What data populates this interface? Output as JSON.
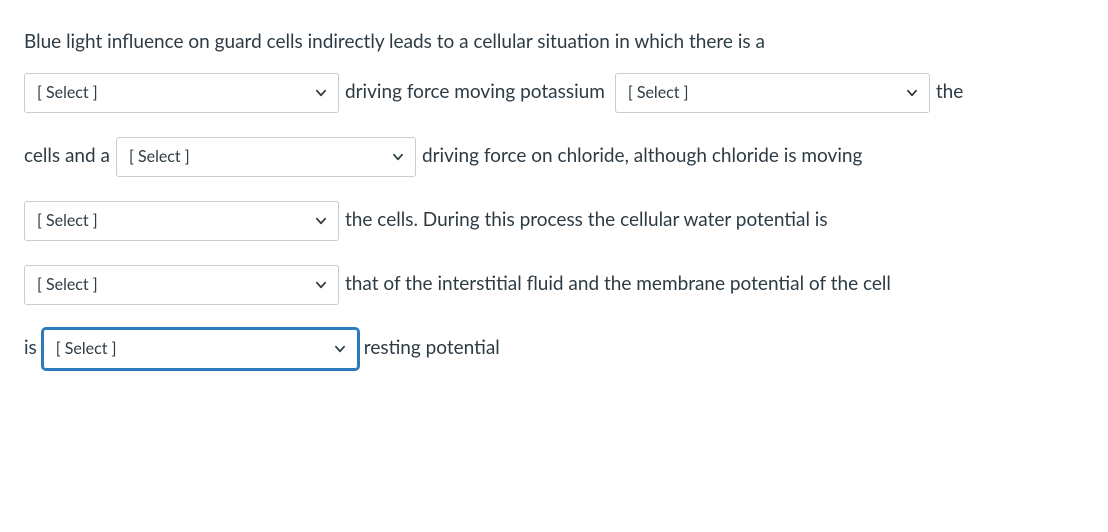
{
  "question": {
    "intro": "Blue light influence on guard cells indirectly leads to a cellular situation in which there is a",
    "fragments": {
      "f1": "driving force moving potassium",
      "f2": "the",
      "f3": "cells and a",
      "f4": "driving force on chloride, although chloride is moving",
      "f5": "the cells.  During this process the cellular water potential is",
      "f6": "that of the interstitial fluid and the membrane potential of the cell",
      "f7": "is",
      "f8": "resting potential"
    },
    "selects": {
      "s1": {
        "placeholder": "[ Select ]",
        "value": ""
      },
      "s2": {
        "placeholder": "[ Select ]",
        "value": ""
      },
      "s3": {
        "placeholder": "[ Select ]",
        "value": ""
      },
      "s4": {
        "placeholder": "[ Select ]",
        "value": ""
      },
      "s5": {
        "placeholder": "[ Select ]",
        "value": ""
      },
      "s6": {
        "placeholder": "[ Select ]",
        "value": ""
      }
    }
  }
}
